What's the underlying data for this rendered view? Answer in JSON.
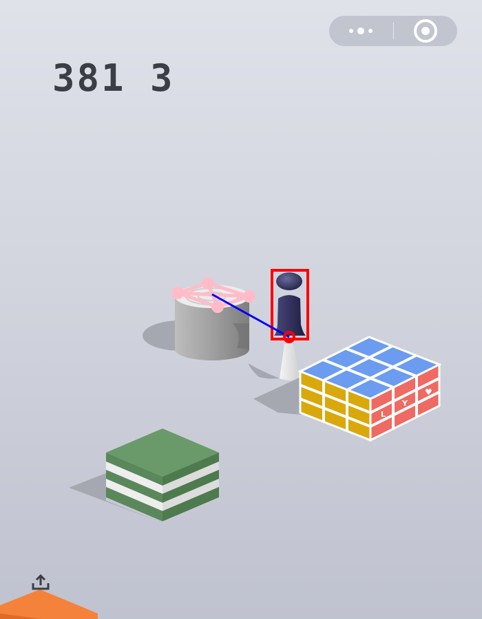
{
  "hud": {
    "score": "381 3"
  },
  "menu_capsule": {
    "more_icon": "more-dots-icon",
    "close_icon": "record-circle-icon"
  },
  "share_icon": "share-upload-icon",
  "tiles": [
    {
      "name": "cylinder-tile",
      "color": "#9a9a9a"
    },
    {
      "name": "rubik-cube-tile",
      "colors": [
        "#6b9cf0",
        "#d9a80d",
        "#ef6a62"
      ],
      "face_text": [
        "L",
        "Y",
        "♥"
      ]
    },
    {
      "name": "green-striped-tile",
      "colors": [
        "#5e8e5e",
        "#ffffff"
      ]
    },
    {
      "name": "orange-tile",
      "color": "#f5823a"
    }
  ],
  "overlay": {
    "box_color": "#ff0000",
    "line_color": "#0000ff",
    "target_marker_color": "#ffb6c1"
  }
}
